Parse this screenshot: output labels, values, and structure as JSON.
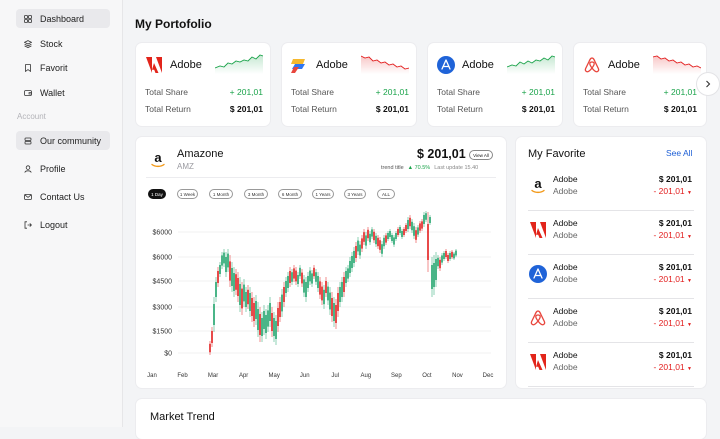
{
  "sidebar": {
    "items": [
      {
        "label": "Dashboard",
        "icon": "grid-icon"
      },
      {
        "label": "Stock",
        "icon": "stack-icon"
      },
      {
        "label": "Favorit",
        "icon": "bookmark-icon"
      },
      {
        "label": "Wallet",
        "icon": "wallet-icon"
      }
    ],
    "section_label": "Account",
    "account_items": [
      {
        "label": "Our community",
        "icon": "community-icon"
      },
      {
        "label": "Profile",
        "icon": "user-icon"
      },
      {
        "label": "Contact Us",
        "icon": "mail-icon"
      },
      {
        "label": "Logout",
        "icon": "logout-icon"
      }
    ]
  },
  "page_title": "My Portofolio",
  "portfolio_cards": [
    {
      "name": "Adobe",
      "logo": "adobe-logo",
      "total_share_label": "Total Share",
      "total_share": "+ 201,01",
      "total_return_label": "Total Return",
      "total_return": "$ 201,01",
      "trend": "up"
    },
    {
      "name": "Adobe",
      "logo": "figma-like-logo",
      "total_share_label": "Total Share",
      "total_share": "+ 201,01",
      "total_return_label": "Total Return",
      "total_return": "$ 201,01",
      "trend": "down"
    },
    {
      "name": "Adobe",
      "logo": "appstore-logo",
      "total_share_label": "Total Share",
      "total_share": "+ 201,01",
      "total_return_label": "Total Return",
      "total_return": "$ 201,01",
      "trend": "up"
    },
    {
      "name": "Adobe",
      "logo": "airbnb-logo",
      "total_share_label": "Total Share",
      "total_share": "+ 201,01",
      "total_return_label": "Total Return",
      "total_return": "$ 201,01",
      "trend": "down"
    }
  ],
  "main_chart": {
    "name": "Amazone",
    "ticker": "AMZ",
    "price": "$ 201,01",
    "view_all": "View All",
    "trend_title": "trend title",
    "trend_value": "▲ 70.5%",
    "last_update": "Last update 15.40",
    "ranges": [
      "1 Day",
      "1 Week",
      "1 Month",
      "3 Month",
      "6 Month",
      "1 Years",
      "3 Years",
      "ALL"
    ],
    "active_range": "1 Day"
  },
  "chart_data": {
    "type": "candlestick",
    "categories": [
      "Jan",
      "Feb",
      "Mar",
      "Apr",
      "May",
      "Jun",
      "Jul",
      "Aug",
      "Sep",
      "Oct",
      "Nov",
      "Dec"
    ],
    "y_tick_labels": [
      "$6000",
      "$6000",
      "$4500",
      "$3000",
      "$1500",
      "$0"
    ],
    "colors": {
      "up": "#1ea36a",
      "down": "#e21d1d",
      "grid": "#e3e3e6"
    }
  },
  "favorites": {
    "title": "My Favorite",
    "see_all": "See All",
    "items": [
      {
        "name": "Adobe",
        "sub": "Adobe",
        "price": "$ 201,01",
        "change": "- 201,01",
        "logo": "amazon-logo"
      },
      {
        "name": "Adobe",
        "sub": "Adobe",
        "price": "$ 201,01",
        "change": "- 201,01",
        "logo": "adobe-logo"
      },
      {
        "name": "Adobe",
        "sub": "Adobe",
        "price": "$ 201,01",
        "change": "- 201,01",
        "logo": "appstore-logo"
      },
      {
        "name": "Adobe",
        "sub": "Adobe",
        "price": "$ 201,01",
        "change": "- 201,01",
        "logo": "airbnb-logo"
      },
      {
        "name": "Adobe",
        "sub": "Adobe",
        "price": "$ 201,01",
        "change": "- 201,01",
        "logo": "adobe-logo"
      }
    ]
  },
  "market_trend": {
    "title": "Market Trend"
  }
}
